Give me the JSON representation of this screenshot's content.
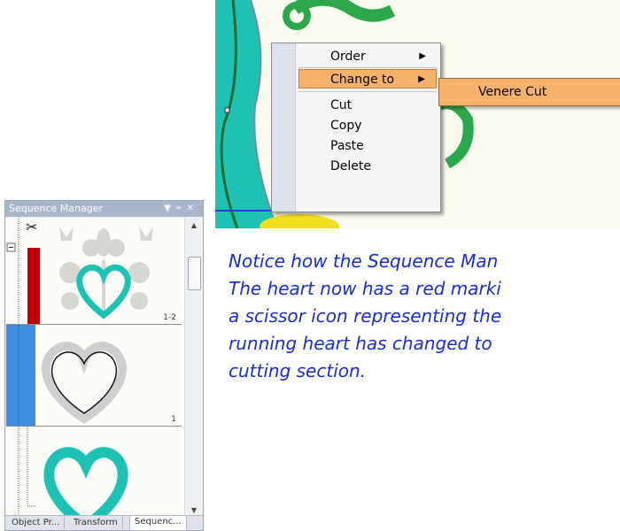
{
  "context_menu": {
    "items": [
      {
        "label": "Order",
        "has_submenu": true
      },
      {
        "label": "Change to",
        "has_submenu": true,
        "highlighted": true
      },
      {
        "label": "Cut"
      },
      {
        "label": "Copy"
      },
      {
        "label": "Paste"
      },
      {
        "label": "Delete"
      }
    ],
    "submenu": {
      "label": "Venere Cut"
    },
    "highlight_color": "#f6b26b"
  },
  "sequence_manager": {
    "title": "Sequence Manager",
    "rows": [
      {
        "number": "1-2",
        "marker": "red",
        "icon": "scissors-icon"
      },
      {
        "number": "1",
        "marker": "blue"
      },
      {
        "number": "",
        "marker": "none"
      }
    ],
    "tabs": [
      "Object Pr...",
      "Transform",
      "Sequenc..."
    ],
    "active_tab": "Sequenc..."
  },
  "caption": {
    "lines": [
      "Notice how the Sequence Man",
      "The heart now has a red marki",
      "a scissor icon representing the",
      "running heart has changed to",
      "cutting section."
    ]
  },
  "colors": {
    "teal": "#1ec2b4",
    "green": "#2aa84a",
    "red_marker": "#c00000",
    "blue_marker": "#3f8fe0",
    "caption": "#1a2ccc"
  }
}
